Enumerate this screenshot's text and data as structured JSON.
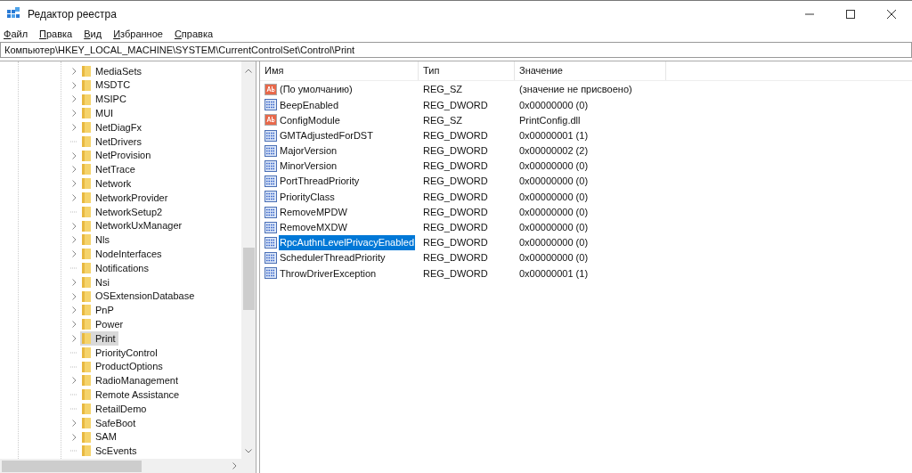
{
  "window": {
    "title": "Редактор реестра"
  },
  "menu": [
    "Файл",
    "Правка",
    "Вид",
    "Избранное",
    "Справка"
  ],
  "address": "Компьютер\\HKEY_LOCAL_MACHINE\\SYSTEM\\CurrentControlSet\\Control\\Print",
  "tree": [
    {
      "label": "MediaSets",
      "kind": "expandable",
      "selected": false
    },
    {
      "label": "MSDTC",
      "kind": "expandable",
      "selected": false
    },
    {
      "label": "MSIPC",
      "kind": "expandable",
      "selected": false
    },
    {
      "label": "MUI",
      "kind": "expandable",
      "selected": false
    },
    {
      "label": "NetDiagFx",
      "kind": "expandable",
      "selected": false
    },
    {
      "label": "NetDrivers",
      "kind": "leaf",
      "selected": false
    },
    {
      "label": "NetProvision",
      "kind": "expandable",
      "selected": false
    },
    {
      "label": "NetTrace",
      "kind": "expandable",
      "selected": false
    },
    {
      "label": "Network",
      "kind": "expandable",
      "selected": false
    },
    {
      "label": "NetworkProvider",
      "kind": "expandable",
      "selected": false
    },
    {
      "label": "NetworkSetup2",
      "kind": "leaf",
      "selected": false
    },
    {
      "label": "NetworkUxManager",
      "kind": "expandable",
      "selected": false
    },
    {
      "label": "Nls",
      "kind": "expandable",
      "selected": false
    },
    {
      "label": "NodeInterfaces",
      "kind": "expandable",
      "selected": false
    },
    {
      "label": "Notifications",
      "kind": "leaf",
      "selected": false
    },
    {
      "label": "Nsi",
      "kind": "expandable",
      "selected": false
    },
    {
      "label": "OSExtensionDatabase",
      "kind": "expandable",
      "selected": false
    },
    {
      "label": "PnP",
      "kind": "expandable",
      "selected": false
    },
    {
      "label": "Power",
      "kind": "expandable",
      "selected": false
    },
    {
      "label": "Print",
      "kind": "expandable",
      "selected": true
    },
    {
      "label": "PriorityControl",
      "kind": "leaf",
      "selected": false
    },
    {
      "label": "ProductOptions",
      "kind": "leaf",
      "selected": false
    },
    {
      "label": "RadioManagement",
      "kind": "expandable",
      "selected": false
    },
    {
      "label": "Remote Assistance",
      "kind": "leaf",
      "selected": false
    },
    {
      "label": "RetailDemo",
      "kind": "leaf",
      "selected": false
    },
    {
      "label": "SafeBoot",
      "kind": "expandable",
      "selected": false
    },
    {
      "label": "SAM",
      "kind": "expandable",
      "selected": false
    },
    {
      "label": "ScEvents",
      "kind": "leaf",
      "selected": false
    }
  ],
  "table": {
    "columns": [
      "Имя",
      "Тип",
      "Значение"
    ],
    "rows": [
      {
        "kind": "sz",
        "name": "(По умолчанию)",
        "type": "REG_SZ",
        "value": "(значение не присвоено)",
        "selected": false
      },
      {
        "kind": "dword",
        "name": "BeepEnabled",
        "type": "REG_DWORD",
        "value": "0x00000000 (0)",
        "selected": false
      },
      {
        "kind": "sz",
        "name": "ConfigModule",
        "type": "REG_SZ",
        "value": "PrintConfig.dll",
        "selected": false
      },
      {
        "kind": "dword",
        "name": "GMTAdjustedForDST",
        "type": "REG_DWORD",
        "value": "0x00000001 (1)",
        "selected": false
      },
      {
        "kind": "dword",
        "name": "MajorVersion",
        "type": "REG_DWORD",
        "value": "0x00000002 (2)",
        "selected": false
      },
      {
        "kind": "dword",
        "name": "MinorVersion",
        "type": "REG_DWORD",
        "value": "0x00000000 (0)",
        "selected": false
      },
      {
        "kind": "dword",
        "name": "PortThreadPriority",
        "type": "REG_DWORD",
        "value": "0x00000000 (0)",
        "selected": false
      },
      {
        "kind": "dword",
        "name": "PriorityClass",
        "type": "REG_DWORD",
        "value": "0x00000000 (0)",
        "selected": false
      },
      {
        "kind": "dword",
        "name": "RemoveMPDW",
        "type": "REG_DWORD",
        "value": "0x00000000 (0)",
        "selected": false
      },
      {
        "kind": "dword",
        "name": "RemoveMXDW",
        "type": "REG_DWORD",
        "value": "0x00000000 (0)",
        "selected": false
      },
      {
        "kind": "dword",
        "name": "RpcAuthnLevelPrivacyEnabled",
        "type": "REG_DWORD",
        "value": "0x00000000 (0)",
        "selected": true
      },
      {
        "kind": "dword",
        "name": "SchedulerThreadPriority",
        "type": "REG_DWORD",
        "value": "0x00000000 (0)",
        "selected": false
      },
      {
        "kind": "dword",
        "name": "ThrowDriverException",
        "type": "REG_DWORD",
        "value": "0x00000001 (1)",
        "selected": false
      }
    ]
  }
}
